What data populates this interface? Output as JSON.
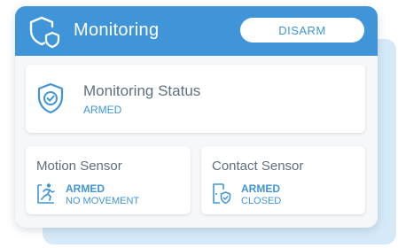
{
  "colors": {
    "accent": "#3f95d8",
    "header_bg": "#3f95d8",
    "backdrop": "#d6e9f8",
    "card_bg": "#f5f7f9",
    "panel_bg": "#ffffff",
    "label_text": "#5f6f80"
  },
  "header": {
    "icon": "shield-lock-icon",
    "title": "Monitoring",
    "disarm_label": "DISARM"
  },
  "status": {
    "icon": "shield-check-icon",
    "title": "Monitoring Status",
    "value": "ARMED"
  },
  "sensors": [
    {
      "icon": "motion-runner-icon",
      "title": "Motion Sensor",
      "state": "ARMED",
      "detail": "NO MOVEMENT"
    },
    {
      "icon": "door-shield-icon",
      "title": "Contact Sensor",
      "state": "ARMED",
      "detail": "CLOSED"
    }
  ]
}
